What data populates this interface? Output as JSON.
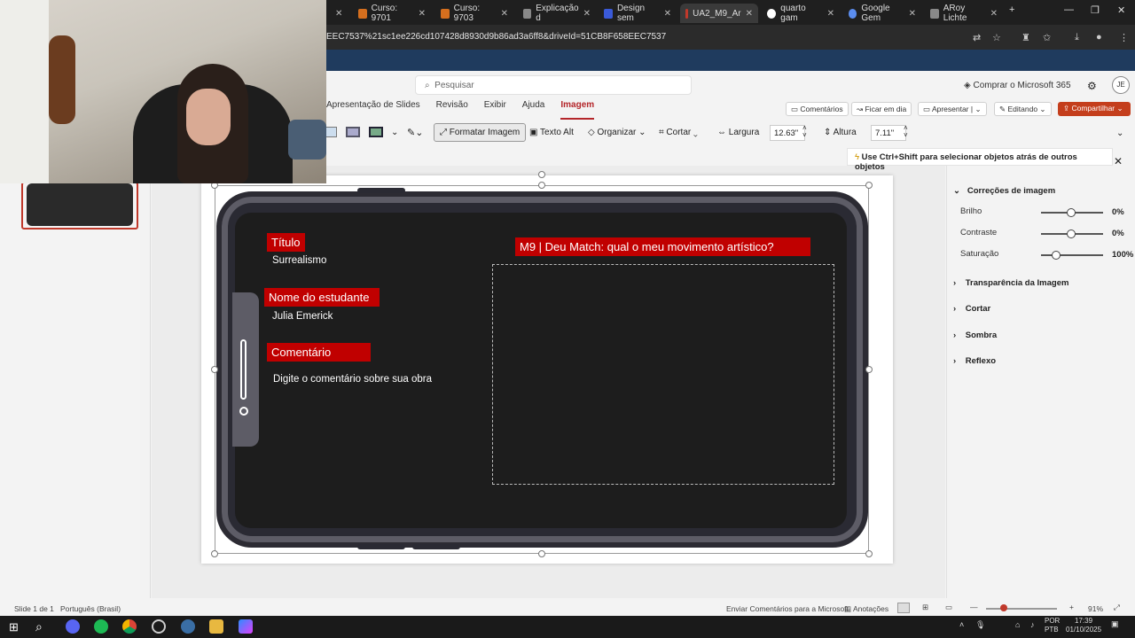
{
  "browser": {
    "tabs": [
      {
        "label": "Curso: 9701",
        "color": "#d66f1e"
      },
      {
        "label": "Curso: 9703",
        "color": "#d66f1e"
      },
      {
        "label": "Explicação d",
        "color": "#888888"
      },
      {
        "label": "Design sem",
        "color": "#3a5ad9"
      },
      {
        "label": "UA2_M9_Ar",
        "color": "#c0392b"
      },
      {
        "label": "quarto gam",
        "color": "#ffffff"
      },
      {
        "label": "Google Gem",
        "color": "#5b8def"
      },
      {
        "label": "ARoy Lichte",
        "color": "#888888"
      }
    ],
    "url": "EEC7537%21sc1ee226cd107428d8930d9b86ad3a6ff8&driveId=51CB8F658EEC7537"
  },
  "office": {
    "search_placeholder": "Pesquisar",
    "buy": "Comprar o Microsoft 365",
    "avatar": "JE",
    "menu": [
      "Apresentação de Slides",
      "Revisão",
      "Exibir",
      "Ajuda",
      "Imagem"
    ],
    "pills": {
      "comments": "Comentários",
      "stay": "Ficar em dia",
      "present": "Apresentar",
      "editing": "Editando",
      "share": "Compartilhar"
    },
    "toolbar": {
      "format": "Formatar Imagem",
      "alt": "Texto Alt",
      "organize": "Organizar",
      "crop": "Cortar",
      "width_label": "Largura",
      "width": "12.63\"",
      "height_label": "Altura",
      "height": "7.11\""
    },
    "tip": "Use Ctrl+Shift para selecionar objetos atrás de outros objetos"
  },
  "slide": {
    "title_label": "Título",
    "title_value": "Surrealismo",
    "student_label": "Nome do estudante",
    "student_value": "Julia Emerick",
    "comment_label": "Comentário",
    "comment_value": "Digite o comentário sobre sua obra",
    "heading": "M9 | Deu Match: qual o meu movimento artístico?"
  },
  "format_pane": {
    "section": "Correções de imagem",
    "brightness": {
      "label": "Brilho",
      "value": "0%"
    },
    "contrast": {
      "label": "Contraste",
      "value": "0%"
    },
    "saturation": {
      "label": "Saturação",
      "value": "100%"
    },
    "others": [
      "Transparência da Imagem",
      "Cortar",
      "Sombra",
      "Reflexo"
    ]
  },
  "status": {
    "slide": "Slide 1 de 1",
    "lang": "Português (Brasil)",
    "feedback": "Enviar Comentários para a Microsoft",
    "notes": "Anotações",
    "zoom": "91%"
  },
  "taskbar": {
    "lang": "POR",
    "layout": "PTB",
    "time": "17:39",
    "date": "01/10/2025"
  }
}
